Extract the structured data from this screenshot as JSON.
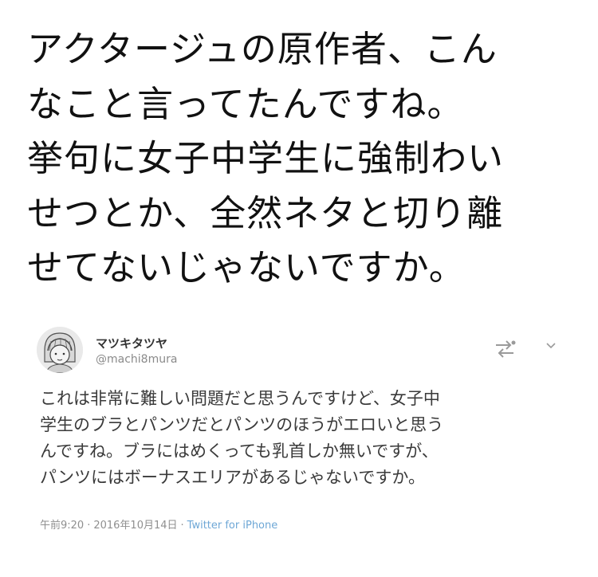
{
  "caption": {
    "lines": [
      "アクタージュの原作者、こん",
      "なこと言ってたんですね。",
      "挙句に女子中学生に強制わい",
      "せつとか、全然ネタと切り離",
      "せてないじゃないですか。"
    ]
  },
  "tweet": {
    "display_name": "マツキタツヤ",
    "handle": "@machi8mura",
    "avatar_icon": "avatar-illustration-icon",
    "follow_icon": "follow-transfer-icon",
    "menu_icon": "chevron-down-icon",
    "body_lines": [
      "これは非常に難しい問題だと思うんですけど、女子中",
      "学生のブラとパンツだとパンツのほうがエロいと思う",
      "んですね。ブラにはめくっても乳首しか無いですが、",
      "パンツにはボーナスエリアがあるじゃないですか。"
    ],
    "time": "午前9:20",
    "separator_1": "·",
    "date": "2016年10月14日",
    "separator_2": "·",
    "source": "Twitter for iPhone"
  },
  "colors": {
    "caption_text": "#111111",
    "tweet_text": "#3a3a3a",
    "meta_text": "#8f8f8f",
    "link_blue": "#6ea7d6"
  }
}
